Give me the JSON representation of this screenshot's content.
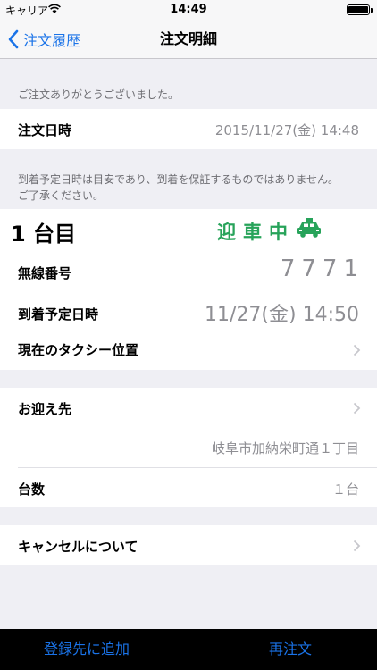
{
  "status_bar": {
    "carrier": "キャリア",
    "time": "14:49"
  },
  "nav": {
    "back_label": "注文履歴",
    "title": "注文明細"
  },
  "notes": {
    "thanks": "ご注文ありがとうございました。",
    "eta_line1": "到着予定日時は目安であり、到着を保証するものではありません。",
    "eta_line2": "ご了承ください。"
  },
  "order": {
    "datetime_label": "注文日時",
    "datetime_value": "2015/11/27(金) 14:48"
  },
  "vehicle": {
    "title": "1 台目",
    "status": "迎車中",
    "radio_label": "無線番号",
    "radio_value": "7771",
    "eta_label": "到着予定日時",
    "eta_value": "11/27(金) 14:50",
    "location_label": "現在のタクシー位置"
  },
  "pickup": {
    "label": "お迎え先",
    "address": "岐阜市加納栄町通１丁目",
    "count_label": "台数",
    "count_value": "１台"
  },
  "cancel": {
    "label": "キャンセルについて"
  },
  "toolbar": {
    "add_label": "登録先に追加",
    "reorder_label": "再注文"
  },
  "colors": {
    "accent": "#1a73e8",
    "status_green": "#27a35a"
  },
  "icons": [
    "wifi-icon",
    "battery-icon",
    "back-chevron-icon",
    "taxi-icon",
    "chevron-right-icon"
  ]
}
